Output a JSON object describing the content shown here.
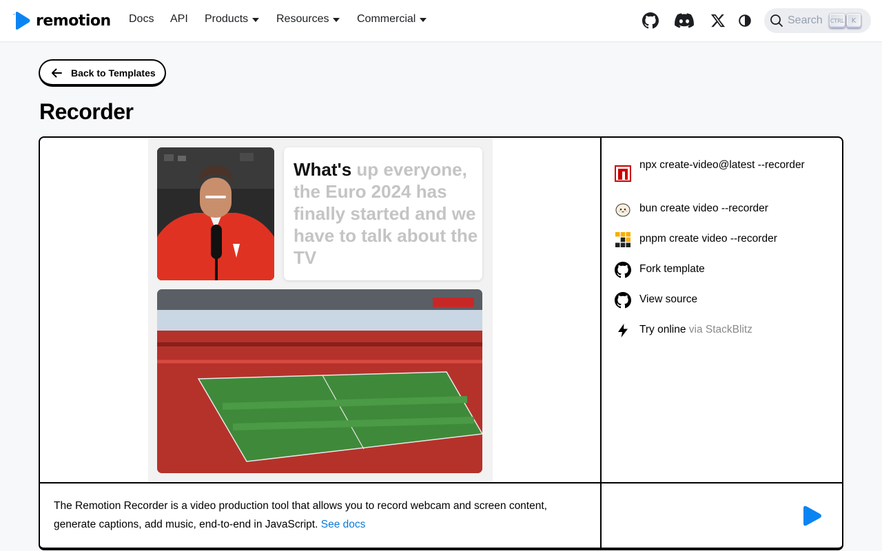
{
  "navbar": {
    "brand": "remotion",
    "links": [
      {
        "label": "Docs",
        "has_dropdown": false
      },
      {
        "label": "API",
        "has_dropdown": false
      },
      {
        "label": "Products",
        "has_dropdown": true
      },
      {
        "label": "Resources",
        "has_dropdown": true
      },
      {
        "label": "Commercial",
        "has_dropdown": true
      }
    ],
    "icons": [
      "github-icon",
      "discord-icon",
      "x-icon",
      "theme-toggle-icon"
    ],
    "search": {
      "placeholder": "Search",
      "kbd_ctrl": "CTRL",
      "kbd_k": "K"
    }
  },
  "back_button": {
    "label": "Back to Templates"
  },
  "page": {
    "title": "Recorder"
  },
  "preview": {
    "caption_highlight": "What's",
    "caption_rest": " up everyone, the Euro 2024 has finally started and we have to talk about the TV"
  },
  "commands": [
    {
      "icon": "npm-icon",
      "text": "npx create-video@latest --recorder",
      "sub": ""
    },
    {
      "icon": "bun-icon",
      "text": "bun create video --recorder",
      "sub": ""
    },
    {
      "icon": "pnpm-icon",
      "text": "pnpm create video --recorder",
      "sub": ""
    },
    {
      "icon": "github-icon",
      "text": "Fork template",
      "sub": ""
    },
    {
      "icon": "github-icon",
      "text": "View source",
      "sub": ""
    },
    {
      "icon": "bolt-icon",
      "text": "Try online",
      "sub": " via StackBlitz"
    }
  ],
  "description": {
    "text": "The Remotion Recorder is a video production tool that allows you to record webcam and screen content, generate captions, add music, end-to-end in JavaScript. ",
    "link": "See docs"
  },
  "colors": {
    "accent": "#0b84f3",
    "link": "#0b7ad8",
    "border": "#000000",
    "background": "#f7f8fa"
  }
}
